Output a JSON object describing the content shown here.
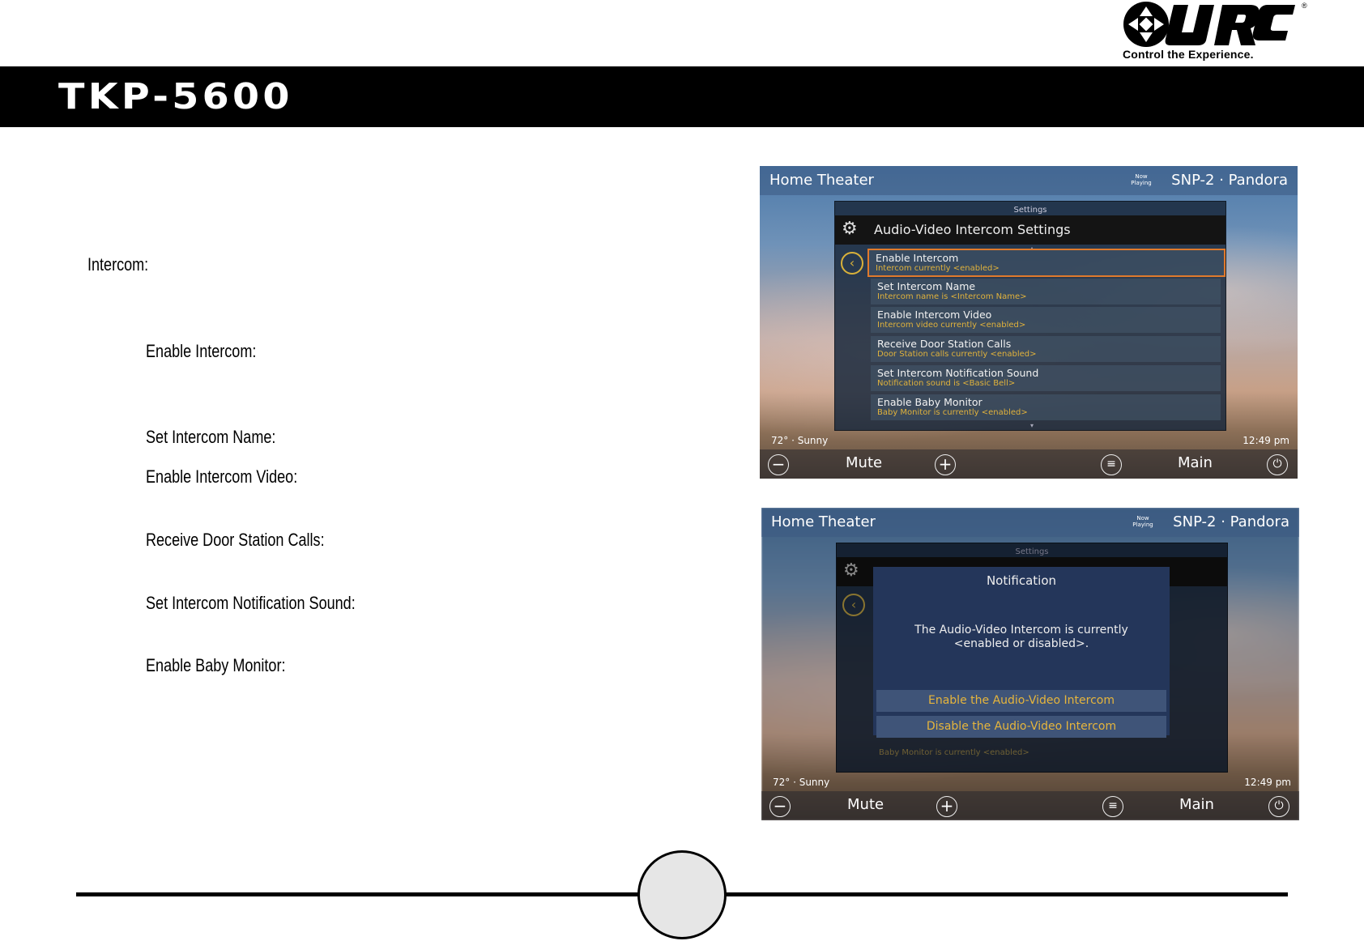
{
  "logo": {
    "brand": "URC",
    "tagline": "Control the Experience.",
    "reg": "®"
  },
  "header": {
    "title": "TKP-5600"
  },
  "labels": {
    "intercom": "Intercom:",
    "items": [
      "Enable Intercom:",
      "Set Intercom Name:",
      "Enable Intercom Video:",
      "Receive Door Station Calls:",
      "Set Intercom Notification Sound:",
      "Enable Baby Monitor:"
    ]
  },
  "screen": {
    "room": "Home Theater",
    "now_playing": "Now Playing",
    "source": "SNP-2 · Pandora",
    "settings_caption": "Settings",
    "panel_title": "Audio-Video Intercom Settings",
    "rows": [
      {
        "title": "Enable Intercom",
        "sub": "Intercom currently <enabled>"
      },
      {
        "title": "Set Intercom Name",
        "sub": "Intercom name is <Intercom Name>"
      },
      {
        "title": "Enable Intercom Video",
        "sub": "Intercom video currently <enabled>"
      },
      {
        "title": "Receive Door Station Calls",
        "sub": "Door Station calls currently <enabled>"
      },
      {
        "title": "Set Intercom Notification Sound",
        "sub": "Notification sound is <Basic Bell>"
      },
      {
        "title": "Enable Baby Monitor",
        "sub": "Baby Monitor is currently <enabled>"
      }
    ],
    "weather": "72° · Sunny",
    "time": "12:49 pm",
    "mute": "Mute",
    "main": "Main"
  },
  "notification": {
    "title": "Notification",
    "message_line1": "The Audio-Video Intercom is currently",
    "message_line2": "<enabled or disabled>.",
    "enable_button": "Enable the Audio-Video Intercom",
    "disable_button": "Disable the Audio-Video Intercom"
  },
  "colors": {
    "header_bg": "#000000",
    "accent_gold": "#e0b23c",
    "selection_orange": "#e07a2c"
  }
}
